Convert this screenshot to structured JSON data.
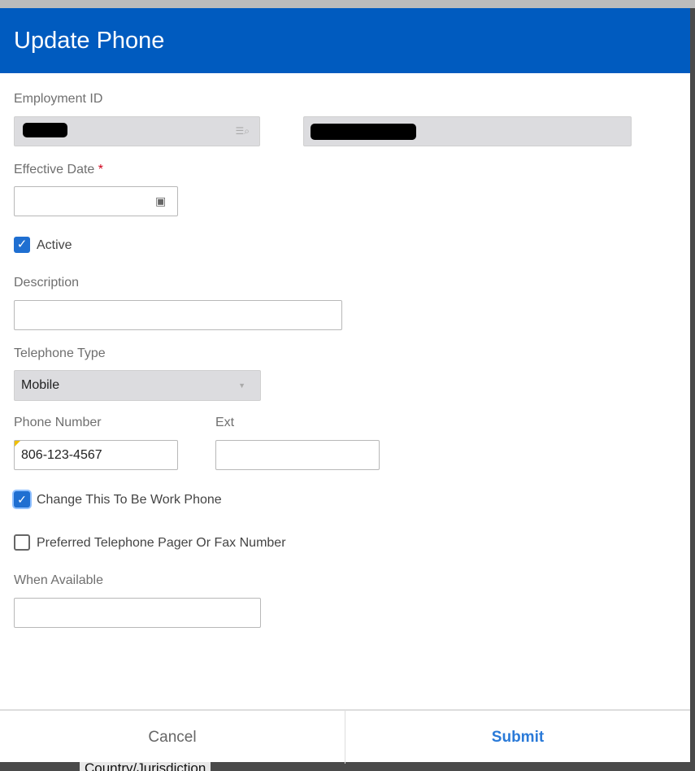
{
  "dialog": {
    "title": "Update Phone"
  },
  "form": {
    "employment_id_label": "Employment ID",
    "effective_date_label": "Effective Date",
    "required_mark": "*",
    "effective_date_value": "",
    "active_label": "Active",
    "active_checked": true,
    "description_label": "Description",
    "description_value": "",
    "telephone_type_label": "Telephone Type",
    "telephone_type_value": "Mobile",
    "phone_number_label": "Phone Number",
    "phone_number_value": "806-123-4567",
    "ext_label": "Ext",
    "ext_value": "",
    "work_phone_label": "Change This To Be Work Phone",
    "work_phone_checked": true,
    "preferred_label": "Preferred Telephone Pager Or Fax Number",
    "preferred_checked": false,
    "when_available_label": "When Available",
    "when_available_value": ""
  },
  "footer": {
    "cancel_label": "Cancel",
    "submit_label": "Submit"
  },
  "background": {
    "partial_text": "Country/Jurisdiction"
  },
  "colors": {
    "header": "#005bbf",
    "checkbox": "#1f6fd1",
    "submit": "#2a7ad8",
    "required": "#d0021b"
  }
}
